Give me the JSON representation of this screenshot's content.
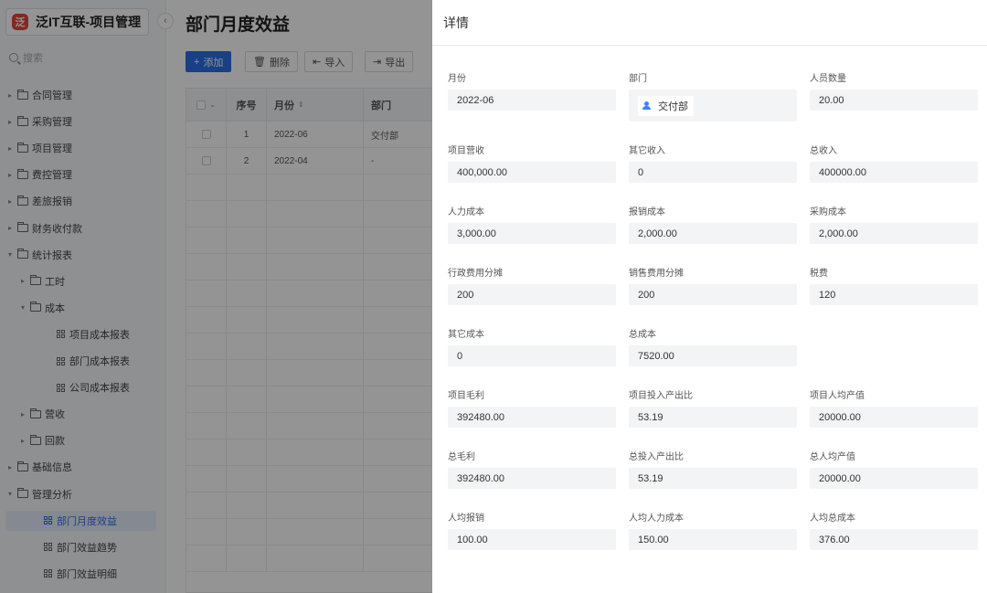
{
  "app": {
    "logo_glyph": "泛",
    "name": "泛IT互联-项目管理"
  },
  "sidebar": {
    "search_placeholder": "搜索",
    "items": [
      {
        "label": "合同管理",
        "level": 0,
        "expanded": false,
        "kind": "folder"
      },
      {
        "label": "采购管理",
        "level": 0,
        "expanded": false,
        "kind": "folder"
      },
      {
        "label": "项目管理",
        "level": 0,
        "expanded": false,
        "kind": "folder"
      },
      {
        "label": "费控管理",
        "level": 0,
        "expanded": false,
        "kind": "folder"
      },
      {
        "label": "差旅报销",
        "level": 0,
        "expanded": false,
        "kind": "folder"
      },
      {
        "label": "财务收付款",
        "level": 0,
        "expanded": false,
        "kind": "folder"
      },
      {
        "label": "统计报表",
        "level": 0,
        "expanded": true,
        "kind": "folder"
      },
      {
        "label": "工时",
        "level": 1,
        "expanded": false,
        "kind": "folder"
      },
      {
        "label": "成本",
        "level": 1,
        "expanded": true,
        "kind": "folder"
      },
      {
        "label": "项目成本报表",
        "level": 2,
        "kind": "page"
      },
      {
        "label": "部门成本报表",
        "level": 2,
        "kind": "page"
      },
      {
        "label": "公司成本报表",
        "level": 2,
        "kind": "page"
      },
      {
        "label": "营收",
        "level": 1,
        "expanded": false,
        "kind": "folder"
      },
      {
        "label": "回款",
        "level": 1,
        "expanded": false,
        "kind": "folder"
      },
      {
        "label": "基础信息",
        "level": 0,
        "expanded": false,
        "kind": "folder"
      },
      {
        "label": "管理分析",
        "level": 0,
        "expanded": true,
        "kind": "folder"
      },
      {
        "label": "部门月度效益",
        "level": 1,
        "kind": "page",
        "active": true
      },
      {
        "label": "部门效益趋势",
        "level": 1,
        "kind": "page"
      },
      {
        "label": "部门效益明细",
        "level": 1,
        "kind": "page"
      }
    ]
  },
  "main": {
    "title": "部门月度效益",
    "toolbar": {
      "add": "添加",
      "delete": "删除",
      "import": "导入",
      "export": "导出"
    },
    "table": {
      "columns": {
        "no": "序号",
        "month": "月份",
        "dept": "部门"
      },
      "rows": [
        {
          "no": "1",
          "month": "2022-06",
          "dept": "交付部"
        },
        {
          "no": "2",
          "month": "2022-04",
          "dept": "-"
        }
      ]
    }
  },
  "drawer": {
    "title": "详情",
    "fields": [
      {
        "label": "月份",
        "value": "2022-06"
      },
      {
        "label": "部门",
        "value": "交付部",
        "type": "dept"
      },
      {
        "label": "人员数量",
        "value": "20.00"
      },
      {
        "label": "项目营收",
        "value": "400,000.00"
      },
      {
        "label": "其它收入",
        "value": "0"
      },
      {
        "label": "总收入",
        "value": "400000.00"
      },
      {
        "label": "人力成本",
        "value": "3,000.00"
      },
      {
        "label": "报销成本",
        "value": "2,000.00"
      },
      {
        "label": "采购成本",
        "value": "2,000.00"
      },
      {
        "label": "行政费用分摊",
        "value": "200"
      },
      {
        "label": "销售费用分摊",
        "value": "200"
      },
      {
        "label": "税费",
        "value": "120"
      },
      {
        "label": "其它成本",
        "value": "0"
      },
      {
        "label": "总成本",
        "value": "7520.00"
      },
      {
        "label": "项目毛利",
        "value": "392480.00"
      },
      {
        "label": "项目投入产出比",
        "value": "53.19"
      },
      {
        "label": "项目人均产值",
        "value": "20000.00"
      },
      {
        "label": "总毛利",
        "value": "392480.00"
      },
      {
        "label": "总投入产出比",
        "value": "53.19"
      },
      {
        "label": "总人均产值",
        "value": "20000.00"
      },
      {
        "label": "人均报销",
        "value": "100.00"
      },
      {
        "label": "人均人力成本",
        "value": "150.00"
      },
      {
        "label": "人均总成本",
        "value": "376.00"
      }
    ]
  },
  "colors": {
    "primary": "#2b6de5",
    "logo": "#e2483d",
    "active_bg": "#e6eefc"
  }
}
